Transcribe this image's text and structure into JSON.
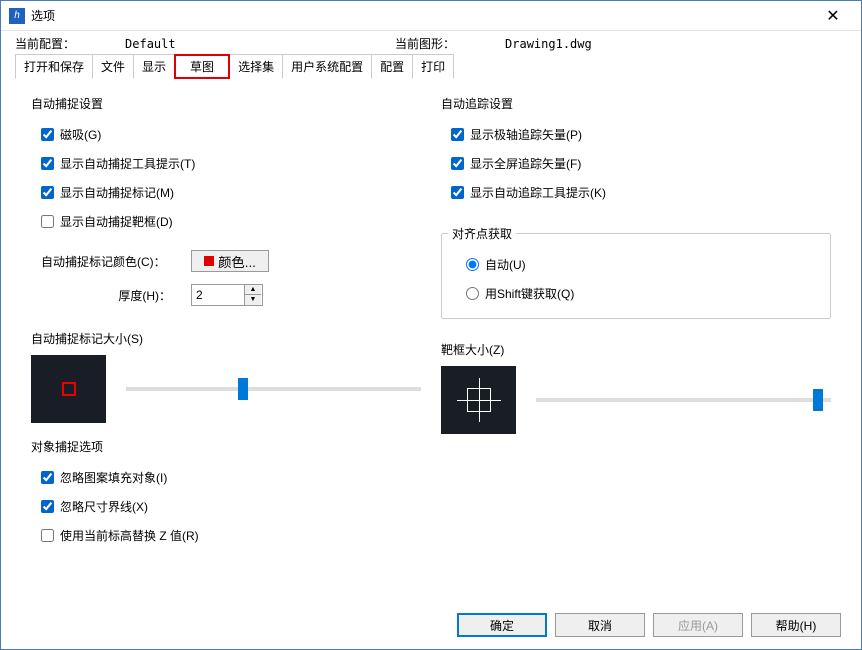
{
  "window": {
    "title": "选项"
  },
  "info": {
    "currentConfigLabel": "当前配置：",
    "currentConfigValue": "Default",
    "currentDrawingLabel": "当前图形：",
    "currentDrawingValue": "Drawing1.dwg"
  },
  "tabs": [
    "打开和保存",
    "文件",
    "显示",
    "草图",
    "选择集",
    "用户系统配置",
    "配置",
    "打印"
  ],
  "activeTab": "草图",
  "autosnap": {
    "title": "自动捕捉设置",
    "items": [
      {
        "label": "磁吸(G)",
        "checked": true
      },
      {
        "label": "显示自动捕捉工具提示(T)",
        "checked": true
      },
      {
        "label": "显示自动捕捉标记(M)",
        "checked": true
      },
      {
        "label": "显示自动捕捉靶框(D)",
        "checked": false
      }
    ],
    "colorLabel": "自动捕捉标记颜色(C)：",
    "colorButton": "颜色...",
    "colorValue": "#e00000",
    "thicknessLabel": "厚度(H)：",
    "thicknessValue": "2"
  },
  "autotrack": {
    "title": "自动追踪设置",
    "items": [
      {
        "label": "显示极轴追踪矢量(P)",
        "checked": true
      },
      {
        "label": "显示全屏追踪矢量(F)",
        "checked": true
      },
      {
        "label": "显示自动追踪工具提示(K)",
        "checked": true
      }
    ]
  },
  "alignment": {
    "title": "对齐点获取",
    "options": [
      {
        "label": "自动(U)",
        "selected": true
      },
      {
        "label": "用Shift键获取(Q)",
        "selected": false
      }
    ]
  },
  "markerSize": {
    "title": "自动捕捉标记大小(S)"
  },
  "apertureSize": {
    "title": "靶框大小(Z)"
  },
  "osnapOptions": {
    "title": "对象捕捉选项",
    "items": [
      {
        "label": "忽略图案填充对象(I)",
        "checked": true
      },
      {
        "label": "忽略尺寸界线(X)",
        "checked": true
      },
      {
        "label": "使用当前标高替换 Z 值(R)",
        "checked": false
      }
    ]
  },
  "buttons": {
    "ok": "确定",
    "cancel": "取消",
    "apply": "应用(A)",
    "help": "帮助(H)"
  }
}
